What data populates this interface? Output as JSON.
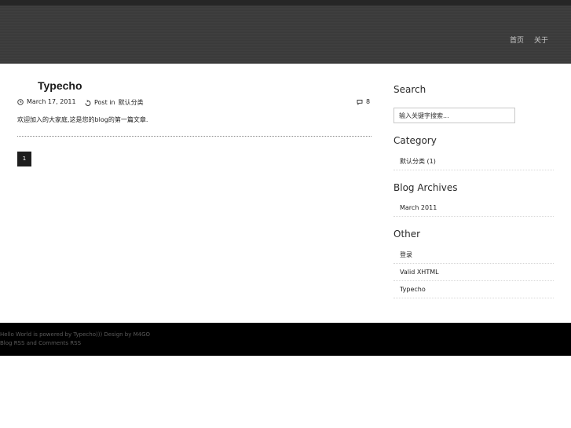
{
  "nav": {
    "items": [
      "首页",
      "关于"
    ]
  },
  "post": {
    "title": "Typecho",
    "date": "March 17, 2011",
    "category_prefix": "Post in",
    "category": "默认分类",
    "comments": "8",
    "excerpt": "欢迎加入的大家庭,这是您的blog的第一篇文章."
  },
  "pagination": {
    "current": "1"
  },
  "sidebar": {
    "search_heading": "Search",
    "search_value": "输入关键字搜索...",
    "category_heading": "Category",
    "categories": [
      {
        "name": "默认分类",
        "count": "(1)"
      }
    ],
    "archives_heading": "Blog Archives",
    "archives": [
      "March 2011"
    ],
    "other_heading": "Other",
    "other": [
      "登录",
      "Valid XHTML",
      "Typecho"
    ]
  },
  "footer": {
    "line1": "Hello World is powered by Typecho))) Design by M4GO",
    "rss1": "Blog RSS",
    "and": "and",
    "rss2": "Comments RSS"
  },
  "colors": {
    "header_bg": "#3d3d3d",
    "footer_bg": "#000000",
    "pager_bg": "#1e1e1e"
  }
}
